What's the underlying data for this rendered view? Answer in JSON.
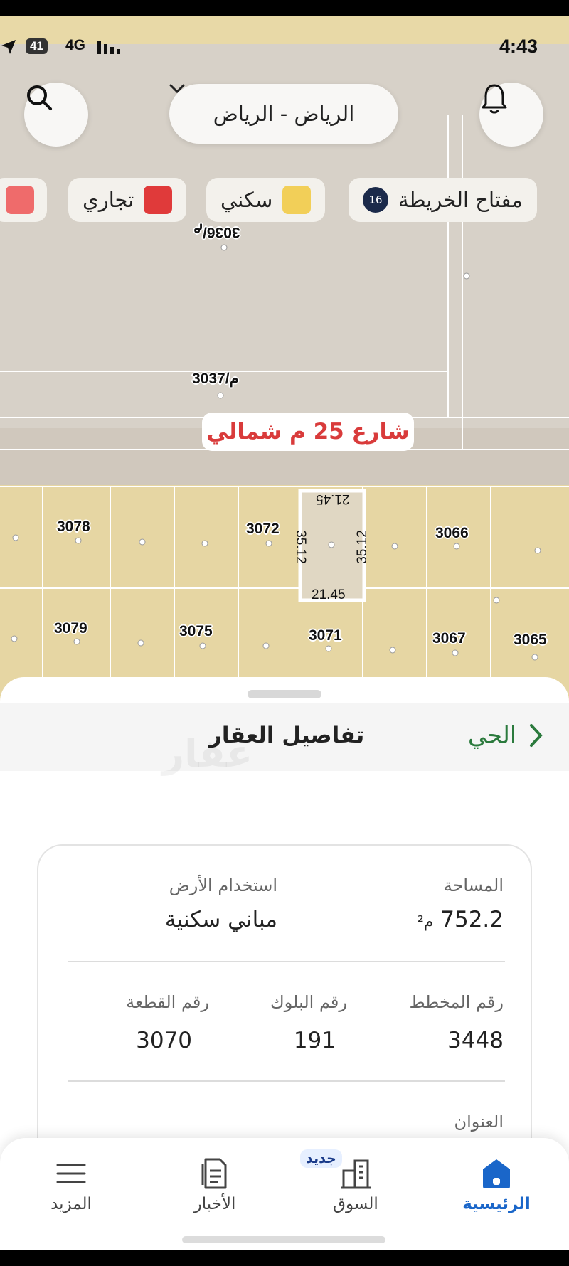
{
  "status_bar": {
    "battery": "41",
    "network": "4G",
    "time": "4:43"
  },
  "top_bar": {
    "city": "الرياض - الرياض"
  },
  "map_legend": {
    "map_key_label": "مفتاح الخريطة",
    "map_key_count": "16",
    "residential_label": "سكني",
    "commercial_label": "تجاري",
    "colors": {
      "residential": "#f2cf58",
      "commercial": "#e03a3a",
      "partial": "#ef6b6b"
    }
  },
  "map": {
    "street": "شارع 25 م شمالي",
    "plots": {
      "p3036": "3036/م",
      "p3037": "3037/م",
      "p3078": "3078",
      "p3072": "3072",
      "p3066": "3066",
      "p3079": "3079",
      "p3075": "3075",
      "p3071": "3071",
      "p3067": "3067",
      "p3065": "3065"
    },
    "dimensions": {
      "top": "21.45",
      "bottom": "21.45",
      "left": "35.12",
      "right": "35.12"
    }
  },
  "sheet": {
    "title": "تفاصيل العقار",
    "district_label": "الحي",
    "watermark": "عقار"
  },
  "details": {
    "area_label": "المساحة",
    "area_value": "752.2",
    "area_unit": "م²",
    "land_use_label": "استخدام الأرض",
    "land_use_value": "مباني سكنية",
    "plan_label": "رقم المخطط",
    "plan_value": "3448",
    "block_label": "رقم البلوك",
    "block_value": "191",
    "plot_label": "رقم القطعة",
    "plot_value": "3070",
    "address_label": "العنوان"
  },
  "bottom_nav": {
    "home": "الرئيسية",
    "market": "السوق",
    "market_badge": "جديد",
    "news": "الأخبار",
    "more": "المزيد"
  }
}
